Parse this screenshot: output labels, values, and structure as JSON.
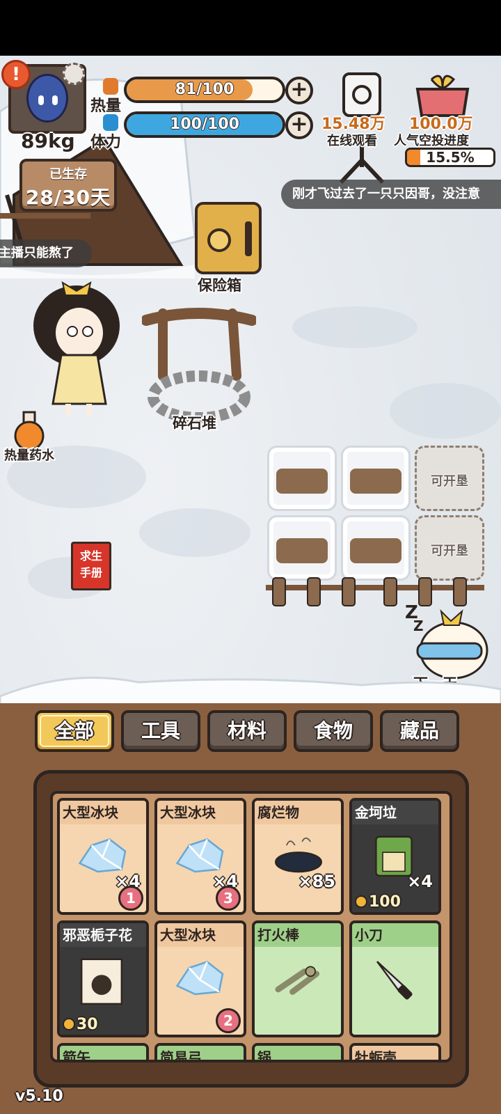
{
  "player": {
    "weight": "89kg",
    "survived_label": "已生存",
    "survived_days": "28/30天"
  },
  "stats": {
    "heat": {
      "label": "热量",
      "text": "81/100",
      "value": 81,
      "max": 100,
      "color": "#e89a4a"
    },
    "stamina": {
      "label": "体力",
      "text": "100/100",
      "value": 100,
      "max": 100,
      "color": "#3fa7e0"
    }
  },
  "live": {
    "viewers": "15.48万",
    "viewers_label": "在线观看",
    "popularity": "100.0万",
    "popularity_label": "人气空投进度",
    "airdrop_progress": "15.5%",
    "airdrop_fraction": 0.155
  },
  "tickers": {
    "right": "刚才飞过去了一只只因哥，没注意",
    "left": "主播只能熬了"
  },
  "scene": {
    "safe_label": "保险箱",
    "rubble_label": "碎石堆",
    "potion_label": "热量药水",
    "manual_line1": "求生",
    "manual_line2": "手册",
    "plot_label": "可开垦",
    "next_day_label": "下一天"
  },
  "tabs": [
    "全部",
    "工具",
    "材料",
    "食物",
    "藏品"
  ],
  "inventory": [
    {
      "name": "大型冰块",
      "qty": "×4",
      "badge": "1",
      "theme": "tan",
      "icon": "ice-icon"
    },
    {
      "name": "大型冰块",
      "qty": "×4",
      "badge": "3",
      "theme": "tan",
      "icon": "ice-icon"
    },
    {
      "name": "腐烂物",
      "qty": "×85",
      "theme": "tan",
      "icon": "rotten-icon"
    },
    {
      "name": "金坷垃",
      "qty": "×4",
      "price": "100",
      "theme": "dark",
      "icon": "fertilizer-bag-icon"
    },
    {
      "name": "邪恶栀子花",
      "price": "30",
      "theme": "dark",
      "icon": "book-icon"
    },
    {
      "name": "大型冰块",
      "badge": "2",
      "theme": "tan",
      "icon": "ice-icon"
    },
    {
      "name": "打火棒",
      "theme": "green",
      "icon": "fire-stick-icon"
    },
    {
      "name": "小刀",
      "theme": "green",
      "icon": "knife-icon"
    },
    {
      "name": "箭矢",
      "theme": "green"
    },
    {
      "name": "简易弓",
      "theme": "green"
    },
    {
      "name": "锅",
      "theme": "green"
    },
    {
      "name": "牡蛎壳",
      "theme": "tan"
    }
  ],
  "version": "v5.10"
}
